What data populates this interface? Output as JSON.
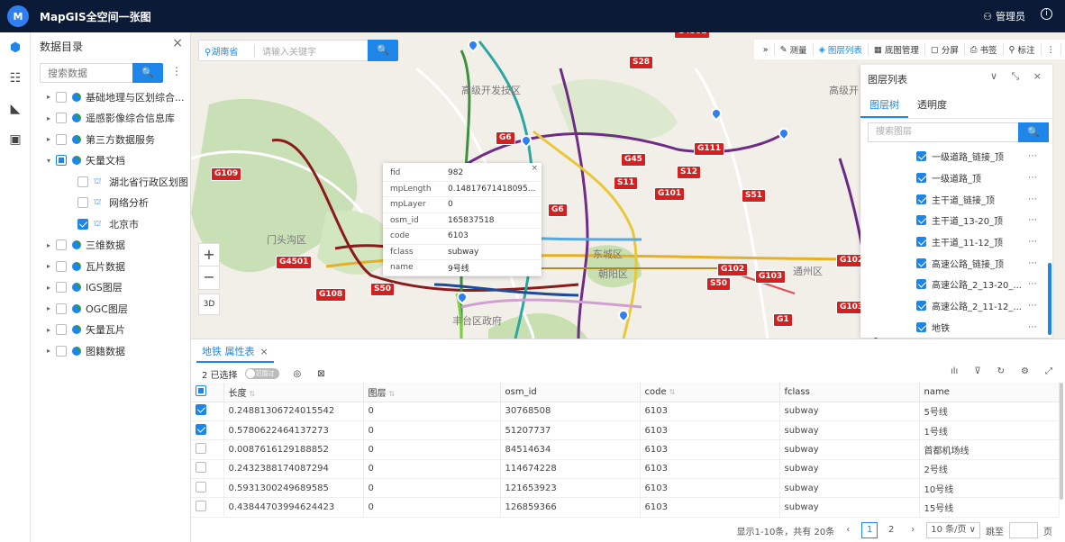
{
  "app": {
    "logo_text": "M",
    "title": "MapGIS全空间一张图",
    "user": "管理员",
    "user_icon": "user-icon",
    "info_icon": "info-icon"
  },
  "leftbar": [
    {
      "name": "cube-icon",
      "glyph": "⬢",
      "active": true
    },
    {
      "name": "list-icon",
      "glyph": "☷",
      "active": false
    },
    {
      "name": "analysis-icon",
      "glyph": "◣",
      "active": false
    },
    {
      "name": "monitor-icon",
      "glyph": "▣",
      "active": false
    }
  ],
  "catalog": {
    "title": "数据目录",
    "close": "×",
    "search_placeholder": "搜索数据",
    "search_btn": "🔍",
    "more": "⋮",
    "items": [
      {
        "label": "基础地理与区划综合...",
        "level": 0,
        "arrow": "▸",
        "check": "none",
        "icon": "db"
      },
      {
        "label": "遥感影像综合信息库",
        "level": 0,
        "arrow": "▸",
        "check": "none",
        "icon": "db"
      },
      {
        "label": "第三方数据服务",
        "level": 0,
        "arrow": "▸",
        "check": "none",
        "icon": "db"
      },
      {
        "label": "矢量文档",
        "level": 0,
        "arrow": "▾",
        "check": "partial",
        "icon": "db"
      },
      {
        "label": "湖北省行政区划图",
        "level": 1,
        "arrow": "",
        "check": "none",
        "icon": "layer"
      },
      {
        "label": "网络分析",
        "level": 1,
        "arrow": "",
        "check": "none",
        "icon": "layer"
      },
      {
        "label": "北京市",
        "level": 1,
        "arrow": "",
        "check": "checked",
        "icon": "layer"
      },
      {
        "label": "三维数据",
        "level": 0,
        "arrow": "▸",
        "check": "none",
        "icon": "db"
      },
      {
        "label": "瓦片数据",
        "level": 0,
        "arrow": "▸",
        "check": "none",
        "icon": "db"
      },
      {
        "label": "IGS图层",
        "level": 0,
        "arrow": "▸",
        "check": "none",
        "icon": "db"
      },
      {
        "label": "OGC图层",
        "level": 0,
        "arrow": "▸",
        "check": "none",
        "icon": "db"
      },
      {
        "label": "矢量瓦片",
        "level": 0,
        "arrow": "▸",
        "check": "none",
        "icon": "db"
      },
      {
        "label": "图籍数据",
        "level": 0,
        "arrow": "▸",
        "check": "none",
        "icon": "db"
      }
    ]
  },
  "map": {
    "search_region": "湖南省",
    "search_placeholder": "请输入关键字",
    "search_clear": "×",
    "search_btn": "🔍",
    "tools": [
      {
        "label": "",
        "icon": "»",
        "active": false
      },
      {
        "label": "测量",
        "icon": "✎",
        "active": false
      },
      {
        "label": "图层列表",
        "icon": "◈",
        "active": true
      },
      {
        "label": "底图管理",
        "icon": "▦",
        "active": false
      },
      {
        "label": "分屏",
        "icon": "▢",
        "active": false
      },
      {
        "label": "书签",
        "icon": "⎙",
        "active": false
      },
      {
        "label": "标注",
        "icon": "⚲",
        "active": false
      },
      {
        "label": "",
        "icon": "⋮",
        "active": false
      }
    ],
    "zoom_in": "+",
    "zoom_out": "−",
    "btn3d": "3D",
    "labels": [
      "高级开发技区",
      "高级开",
      "门头沟区",
      "东城区",
      "朝阳区",
      "通州区",
      "丰台区政府"
    ],
    "shields": [
      "G4501",
      "S28",
      "G6",
      "G45",
      "G111",
      "S11",
      "G101",
      "S12",
      "G109",
      "S51",
      "G6",
      "G4501",
      "G108",
      "S50",
      "G102",
      "G1",
      "G103",
      "S50",
      "G103",
      "G102"
    ],
    "popup": {
      "close": "×",
      "rows": [
        {
          "k": "fid",
          "v": "982"
        },
        {
          "k": "mpLength",
          "v": "0.14817671418095..."
        },
        {
          "k": "mpLayer",
          "v": "0"
        },
        {
          "k": "osm_id",
          "v": "165837518"
        },
        {
          "k": "code",
          "v": "6103"
        },
        {
          "k": "fclass",
          "v": "subway"
        },
        {
          "k": "name",
          "v": "9号线"
        }
      ]
    }
  },
  "layer_panel": {
    "title": "图层列表",
    "controls": "∨ ⤡ ×",
    "tabs": [
      "图层树",
      "透明度"
    ],
    "search_placeholder": "搜索图层",
    "search_btn": "🔍",
    "items": [
      "一级道路_链接_顶",
      "一级道路_顶",
      "主干道_链接_顶",
      "主干道_13-20_顶",
      "主干道_11-12_顶",
      "高速公路_链接_顶",
      "高速公路_2_13-20_...",
      "高速公路_2_11-12_...",
      "地铁"
    ],
    "dots": "⋯"
  },
  "table": {
    "tab_label": "地铁 属性表",
    "tab_close": "×",
    "selected_text": "2 已选择",
    "toggle_text": "范围过滤",
    "tool_icons_right": [
      "chart-icon",
      "filter-icon",
      "refresh-icon",
      "settings-icon",
      "expand-icon"
    ],
    "tool_glyphs_right": [
      "ılı",
      "⊽",
      "↻",
      "⚙",
      "⤢"
    ],
    "columns": [
      "长度",
      "图层",
      "osm_id",
      "code",
      "fclass",
      "name"
    ],
    "sortable": [
      true,
      true,
      false,
      true,
      false,
      false
    ],
    "rows": [
      {
        "checked": true,
        "cells": [
          "0.24881306724015542",
          "0",
          "30768508",
          "6103",
          "subway",
          "5号线"
        ]
      },
      {
        "checked": true,
        "cells": [
          "0.5780622464137273",
          "0",
          "51207737",
          "6103",
          "subway",
          "1号线"
        ]
      },
      {
        "checked": false,
        "cells": [
          "0.0087616129188852",
          "0",
          "84514634",
          "6103",
          "subway",
          "首都机场线"
        ]
      },
      {
        "checked": false,
        "cells": [
          "0.2432388174087294",
          "0",
          "114674228",
          "6103",
          "subway",
          "2号线"
        ]
      },
      {
        "checked": false,
        "cells": [
          "0.5931300249689585",
          "0",
          "121653923",
          "6103",
          "subway",
          "10号线"
        ]
      },
      {
        "checked": false,
        "cells": [
          "0.43844703994624423",
          "0",
          "126859366",
          "6103",
          "subway",
          "15号线"
        ]
      }
    ],
    "pager": {
      "summary": "显示1-10条，共有 20条",
      "prev": "‹",
      "pages": [
        "1",
        "2"
      ],
      "next": "›",
      "page_size": "10 条/页 ∨",
      "goto_label": "跳至",
      "goto_unit": "页"
    }
  }
}
